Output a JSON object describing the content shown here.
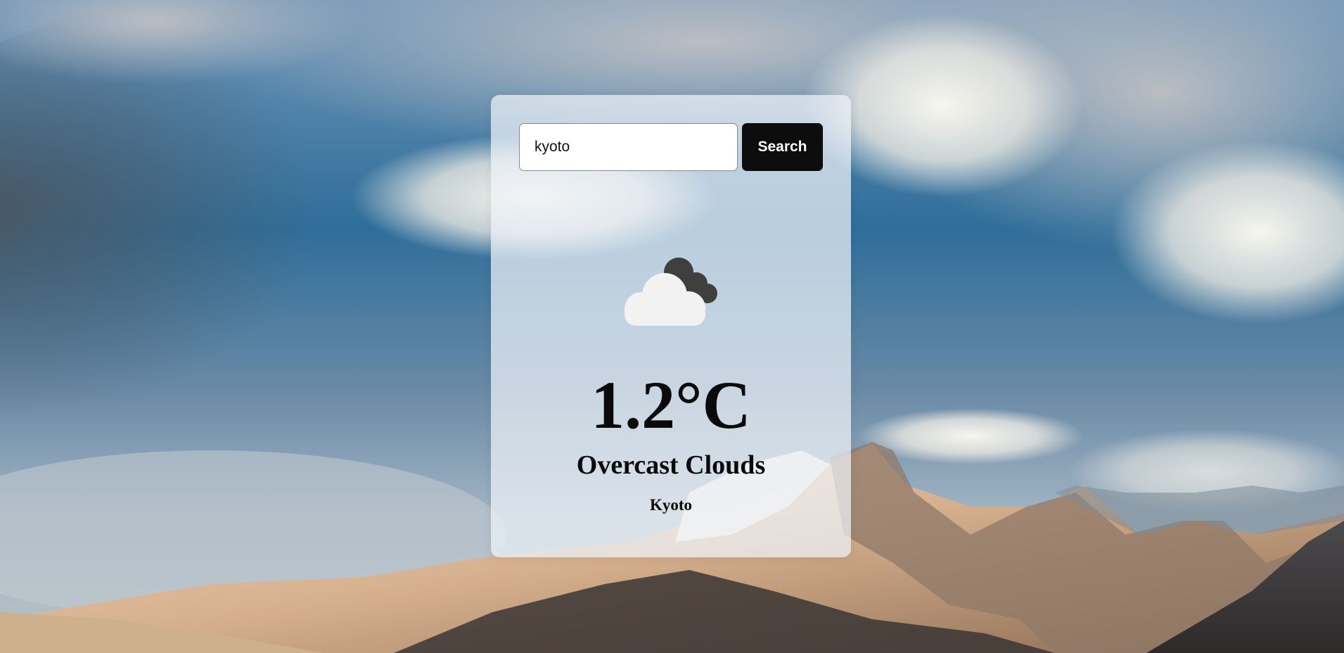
{
  "search": {
    "value": "kyoto",
    "button_label": "Search"
  },
  "weather": {
    "icon": "overcast-clouds-icon",
    "temperature": "1.2°C",
    "description": "Overcast Clouds",
    "city": "Kyoto"
  },
  "colors": {
    "button_bg": "#0d0d0d",
    "button_text": "#ffffff",
    "text": "#0a0a0a",
    "cloud_front": "#f2f2f2",
    "cloud_back": "#3f3f3f"
  }
}
